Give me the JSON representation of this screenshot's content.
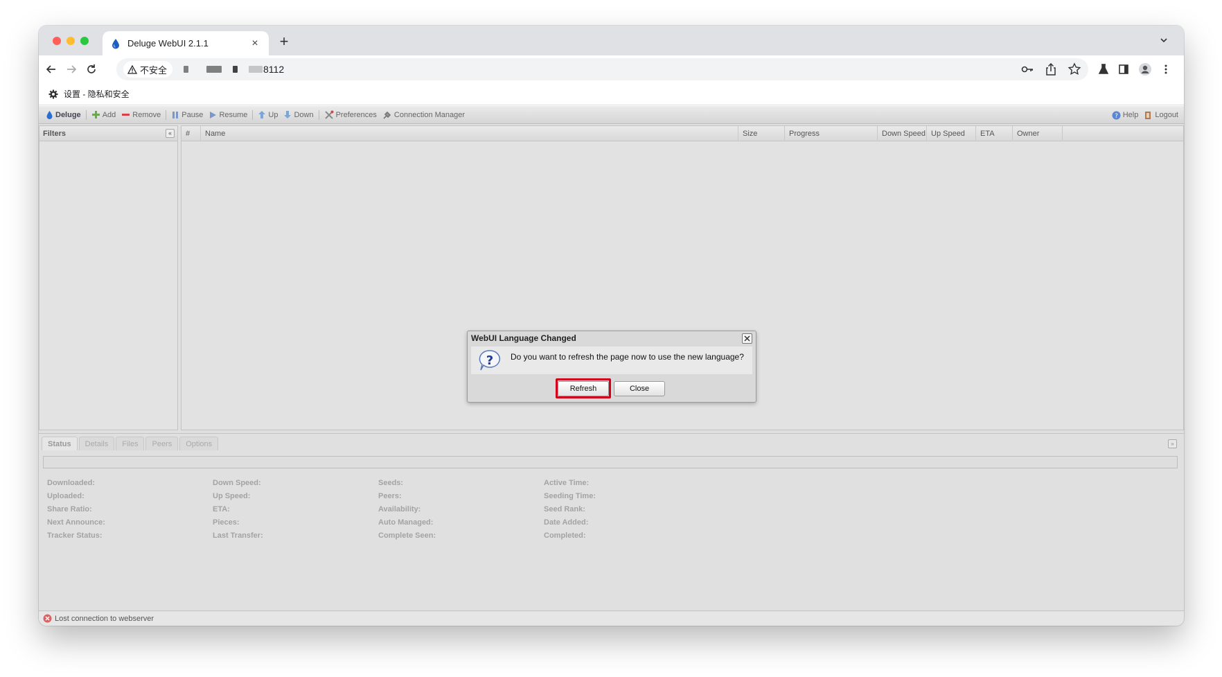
{
  "browser": {
    "tab_title": "Deluge WebUI 2.1.1",
    "tab_close": "×",
    "new_tab": "+",
    "security_label": "不安全",
    "url_port_text": "8112",
    "bookmark_label": "设置 - 隐私和安全"
  },
  "app": {
    "toolbar": {
      "brand": "Deluge",
      "add": "Add",
      "remove": "Remove",
      "pause": "Pause",
      "resume": "Resume",
      "up": "Up",
      "down": "Down",
      "preferences": "Preferences",
      "connection_manager": "Connection Manager",
      "help": "Help",
      "logout": "Logout"
    },
    "filters": {
      "title": "Filters",
      "collapse_glyph": "«"
    },
    "grid": {
      "columns": [
        "#",
        "Name",
        "Size",
        "Progress",
        "Down Speed",
        "Up Speed",
        "ETA",
        "Owner"
      ]
    },
    "details": {
      "tabs": [
        "Status",
        "Details",
        "Files",
        "Peers",
        "Options"
      ],
      "active_tab": "Status",
      "collapse_glyph": "»",
      "col1": [
        "Downloaded:",
        "Uploaded:",
        "Share Ratio:",
        "Next Announce:",
        "Tracker Status:"
      ],
      "col2": [
        "Down Speed:",
        "Up Speed:",
        "ETA:",
        "Pieces:",
        "Last Transfer:"
      ],
      "col3": [
        "Seeds:",
        "Peers:",
        "Availability:",
        "Auto Managed:",
        "Complete Seen:"
      ],
      "col4": [
        "Active Time:",
        "Seeding Time:",
        "Seed Rank:",
        "Date Added:",
        "Completed:"
      ]
    },
    "statusbar": {
      "message": "Lost connection to webserver"
    }
  },
  "modal": {
    "title": "WebUI Language Changed",
    "message": "Do you want to refresh the page now to use the new language?",
    "refresh_label": "Refresh",
    "close_label": "Close"
  },
  "colors": {
    "highlight": "#d0021b",
    "deluge_blue": "#1d6fd8"
  }
}
